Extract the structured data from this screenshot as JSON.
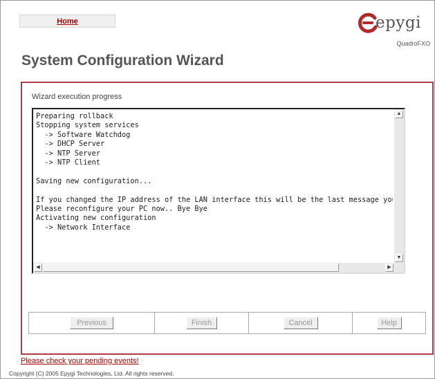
{
  "nav": {
    "home_label": "Home"
  },
  "logo": {
    "brand": "epygi",
    "model": "QuadroFXO",
    "accent_color": "#b02a2a"
  },
  "page": {
    "title": "System Configuration Wizard"
  },
  "wizard": {
    "progress_label": "Wizard execution progress",
    "log_lines": [
      "Preparing rollback",
      "Stopping system services",
      "  -> Software Watchdog",
      "  -> DHCP Server",
      "  -> NTP Server",
      "  -> NTP Client",
      "",
      "Saving new configuration...",
      "",
      "If you changed the IP address of the LAN interface this will be the last message you",
      "Please reconfigure your PC now.. Bye Bye",
      "Activating new configuration",
      "  -> Network Interface"
    ]
  },
  "buttons": {
    "previous": "Previous",
    "finish": "Finish",
    "cancel": "Cancel",
    "help": "Help"
  },
  "footer": {
    "pending_link": "Please check your pending events!",
    "copyright": "Copyright (C) 2005 Epygi Technologies, Ltd. All rights reserved."
  },
  "colors": {
    "panel_border": "#b03a45",
    "link": "#aa0000"
  }
}
